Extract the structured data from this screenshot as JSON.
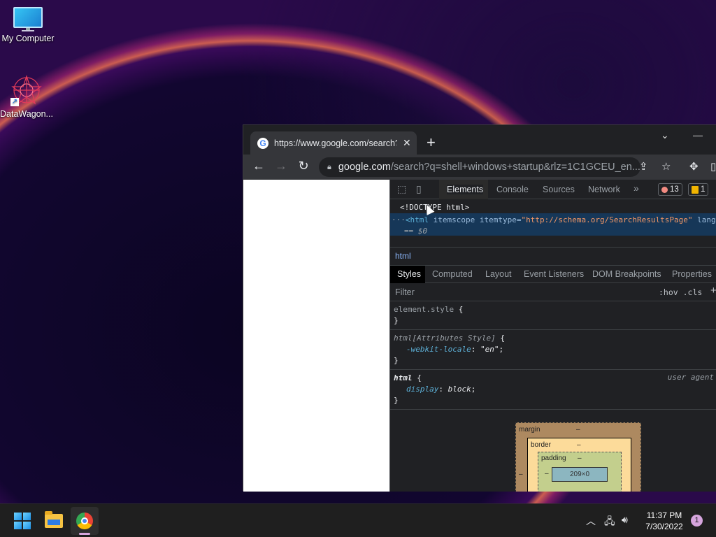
{
  "desktop": {
    "icons": [
      {
        "label": "My Computer"
      },
      {
        "label": "DataWagon..."
      }
    ]
  },
  "browser": {
    "tab": {
      "title": "https://www.google.com/search?",
      "favicon": "G"
    },
    "omnibox": {
      "domain": "google.com",
      "path": "/search?q=shell+windows+startup&rlz=1C1GCEU_en..."
    }
  },
  "devtools": {
    "tabs": [
      "Elements",
      "Console",
      "Sources",
      "Network"
    ],
    "active_tab": "Elements",
    "more": "»",
    "errors_count": "13",
    "warnings_count": "1",
    "dom": {
      "doctype": "<!DOCTYPE html>",
      "html_prefix": "···",
      "html_tag": "<html",
      "html_attr1": " itemscope itemtype=",
      "html_val1": "\"http://schema.org/SearchResultsPage\"",
      "html_attr2": " lang=",
      "html_val2": "\"",
      "eq_ref": "== $0"
    },
    "breadcrumb": "html",
    "style_tabs": [
      "Styles",
      "Computed",
      "Layout",
      "Event Listeners",
      "DOM Breakpoints",
      "Properties"
    ],
    "filter": {
      "placeholder": "Filter",
      "hov_cls": ":hov  .cls",
      "plus": "+"
    },
    "rules": [
      {
        "selector": "element.style",
        "brace_open": " {",
        "brace_close": "}"
      },
      {
        "selector": "html[Attributes Style]",
        "brace_open": " {",
        "prop": "-webkit-locale",
        "value": "\"en\"",
        "brace_close": "}"
      },
      {
        "selector": "html",
        "brace_open": " {",
        "prop": "display",
        "value": "block",
        "source": "user agent",
        "brace_close": "}"
      }
    ],
    "box_model": {
      "margin_label": "margin",
      "border_label": "border",
      "padding_label": "padding",
      "content": "209×0",
      "dash": "–"
    }
  },
  "taskbar": {
    "time": "11:37 PM",
    "date": "7/30/2022",
    "notifications": "1"
  }
}
